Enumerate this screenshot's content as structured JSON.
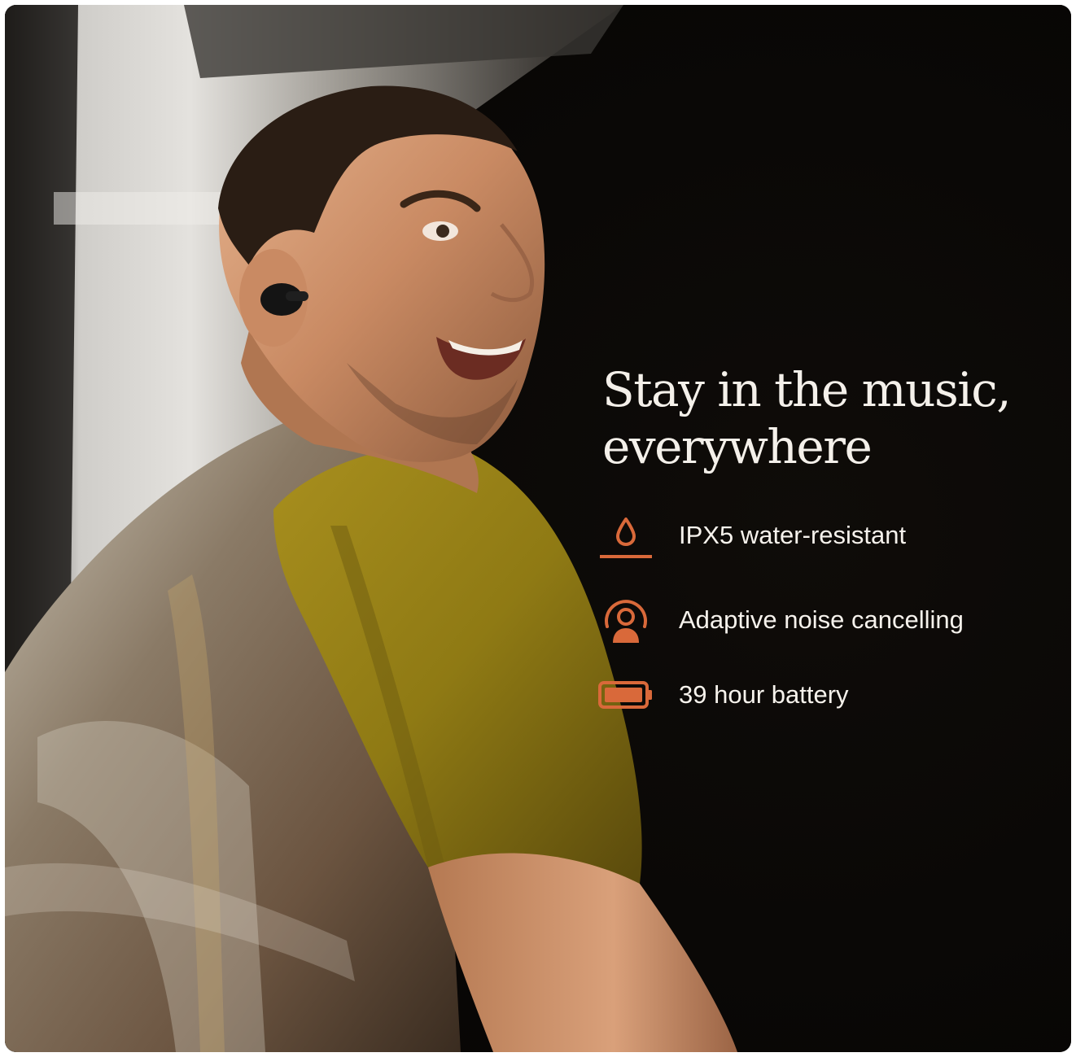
{
  "headline": {
    "line1": "Stay in the music,",
    "line2": "everywhere"
  },
  "features": [
    {
      "icon": "water-drop-icon",
      "label": "IPX5 water-resistant"
    },
    {
      "icon": "noise-cancelling-icon",
      "label": "Adaptive noise cancelling"
    },
    {
      "icon": "battery-icon",
      "label": "39 hour battery"
    }
  ],
  "colors": {
    "accent": "#D9693A",
    "text": "#F4F0EA",
    "background": "#0B0907"
  }
}
